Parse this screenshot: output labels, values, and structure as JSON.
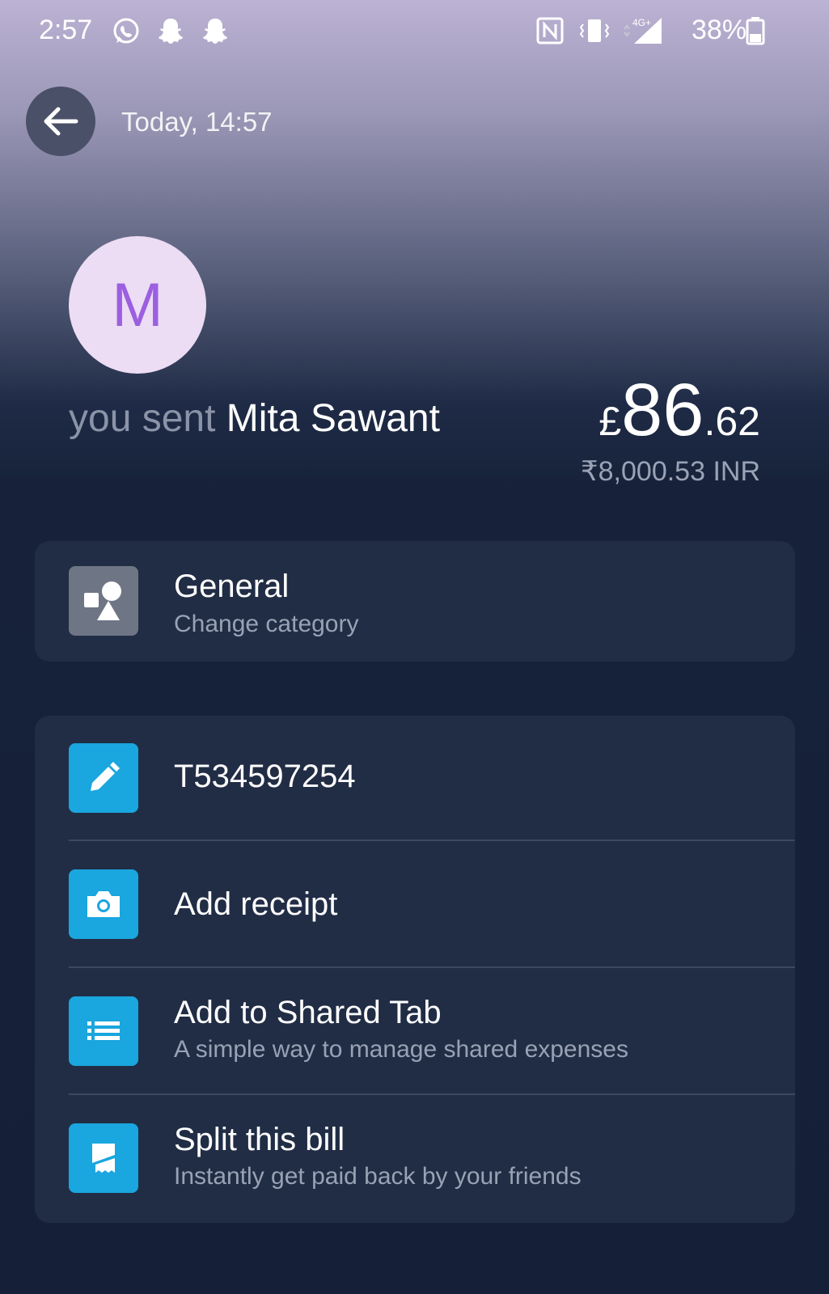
{
  "status_bar": {
    "time": "2:57",
    "battery_percent": "38%",
    "network": "4G+"
  },
  "header": {
    "date": "Today, 14:57"
  },
  "contact": {
    "initial": "M",
    "sent_prefix": "you sent",
    "name": "Mita Sawant"
  },
  "amount": {
    "currency_symbol": "£",
    "whole": "86",
    "decimal": ".62",
    "converted": "₹8,000.53 INR"
  },
  "category": {
    "title": "General",
    "subtitle": "Change category"
  },
  "actions": [
    {
      "title": "T534597254",
      "subtitle": ""
    },
    {
      "title": "Add receipt",
      "subtitle": ""
    },
    {
      "title": "Add to Shared Tab",
      "subtitle": "A simple way to manage shared expenses"
    },
    {
      "title": "Split this bill",
      "subtitle": "Instantly get paid back by your friends"
    }
  ],
  "colors": {
    "accent_blue": "#1aa6de",
    "card_bg": "#212d45",
    "avatar_bg": "#ecdcf4",
    "avatar_text": "#9b5fe0"
  }
}
